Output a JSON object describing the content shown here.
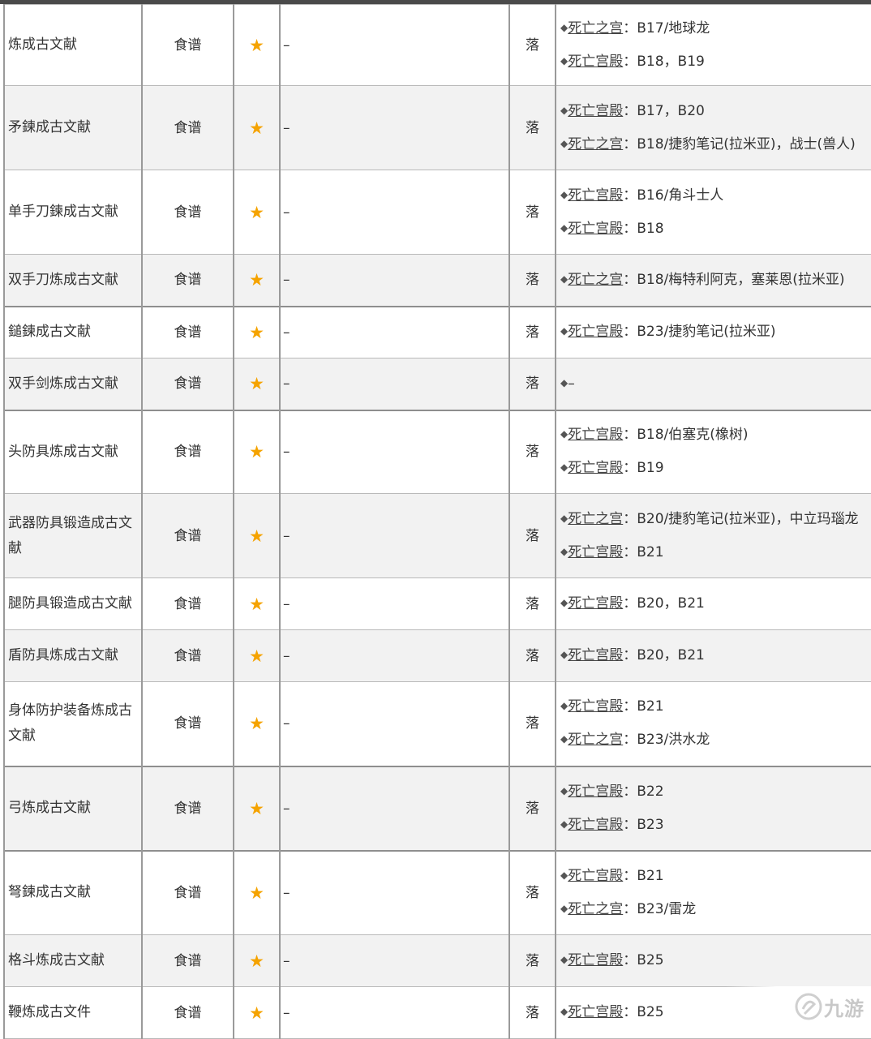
{
  "rows": [
    {
      "name": "炼成古文献",
      "type": "食谱",
      "star": "★",
      "dash": "–",
      "drop": "落",
      "sources": [
        {
          "place": "死亡之宫",
          "detail": "：B17/地球龙"
        },
        {
          "place": "死亡宫殿",
          "detail": "：B18，B19"
        }
      ]
    },
    {
      "name": "矛鍊成古文献",
      "type": "食谱",
      "star": "★",
      "dash": "–",
      "drop": "落",
      "sources": [
        {
          "place": "死亡宫殿",
          "detail": "：B17，B20"
        },
        {
          "place": "死亡之宫",
          "detail": "：B18/捷豹笔记(拉米亚)，战士(兽人)"
        }
      ]
    },
    {
      "name": "单手刀鍊成古文献",
      "type": "食谱",
      "star": "★",
      "dash": "–",
      "drop": "落",
      "sources": [
        {
          "place": "死亡宫殿",
          "detail": "：B16/角斗士人"
        },
        {
          "place": "死亡宫殿",
          "detail": "：B18"
        }
      ]
    },
    {
      "name": "双手刀炼成古文献",
      "type": "食谱",
      "star": "★",
      "dash": "–",
      "drop": "落",
      "sources": [
        {
          "place": "死亡之宫",
          "detail": "：B18/梅特利阿克，塞莱恩(拉米亚)"
        }
      ]
    },
    {
      "name": "鎚鍊成古文献",
      "type": "食谱",
      "star": "★",
      "dash": "–",
      "drop": "落",
      "sources": [
        {
          "place": "死亡宫殿",
          "detail": "：B23/捷豹笔记(拉米亚)"
        }
      ]
    },
    {
      "name": "双手剑炼成古文献",
      "type": "食谱",
      "star": "★",
      "dash": "–",
      "drop": "落",
      "sources": [
        {
          "place": "",
          "detail": "–"
        }
      ]
    },
    {
      "name": "头防具炼成古文献",
      "type": "食谱",
      "star": "★",
      "dash": "–",
      "drop": "落",
      "sources": [
        {
          "place": "死亡宫殿",
          "detail": "：B18/伯塞克(橡树)"
        },
        {
          "place": "死亡宫殿",
          "detail": "：B19"
        }
      ]
    },
    {
      "name": "武器防具锻造成古文献",
      "type": "食谱",
      "star": "★",
      "dash": "–",
      "drop": "落",
      "sources": [
        {
          "place": "死亡之宫",
          "detail": "：B20/捷豹笔记(拉米亚)，中立玛瑙龙"
        },
        {
          "place": "死亡宫殿",
          "detail": "：B21"
        }
      ]
    },
    {
      "name": "腿防具锻造成古文献",
      "type": "食谱",
      "star": "★",
      "dash": "–",
      "drop": "落",
      "sources": [
        {
          "place": "死亡宫殿",
          "detail": "：B20，B21"
        }
      ]
    },
    {
      "name": "盾防具炼成古文献",
      "type": "食谱",
      "star": "★",
      "dash": "–",
      "drop": "落",
      "sources": [
        {
          "place": "死亡宫殿",
          "detail": "：B20，B21"
        }
      ]
    },
    {
      "name": "身体防护装备炼成古文献",
      "type": "食谱",
      "star": "★",
      "dash": "–",
      "drop": "落",
      "sources": [
        {
          "place": "死亡宫殿",
          "detail": "：B21"
        },
        {
          "place": "死亡之宫",
          "detail": "：B23/洪水龙"
        }
      ]
    },
    {
      "name": "弓炼成古文献",
      "type": "食谱",
      "star": "★",
      "dash": "–",
      "drop": "落",
      "sources": [
        {
          "place": "死亡宫殿",
          "detail": "：B22"
        },
        {
          "place": "死亡宫殿",
          "detail": "：B23"
        }
      ]
    },
    {
      "name": "弩鍊成古文献",
      "type": "食谱",
      "star": "★",
      "dash": "–",
      "drop": "落",
      "sources": [
        {
          "place": "死亡宫殿",
          "detail": "：B21"
        },
        {
          "place": "死亡之宫",
          "detail": "：B23/雷龙"
        }
      ]
    },
    {
      "name": "格斗炼成古文献",
      "type": "食谱",
      "star": "★",
      "dash": "–",
      "drop": "落",
      "sources": [
        {
          "place": "死亡宫殿",
          "detail": "：B25"
        }
      ]
    },
    {
      "name": "鞭炼成古文件",
      "type": "食谱",
      "star": "★",
      "dash": "–",
      "drop": "落",
      "sources": [
        {
          "place": "死亡宫殿",
          "detail": "：B25"
        }
      ]
    }
  ],
  "watermark": {
    "text": "九游",
    "icon": "nine-game-logo-icon"
  },
  "colors": {
    "star": "#f5a300",
    "alt_row": "#f2f2f2",
    "border": "#b9b9b9"
  }
}
